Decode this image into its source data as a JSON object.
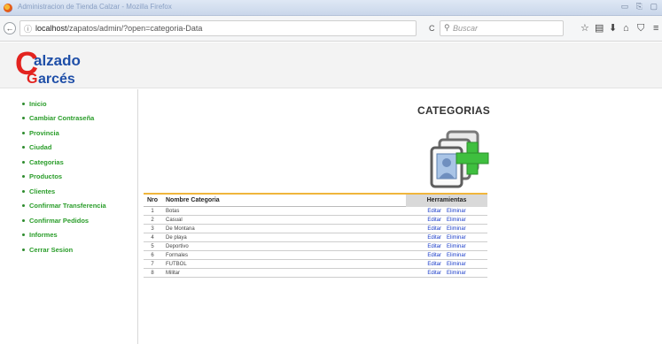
{
  "browser": {
    "window_title": "Administracion de Tienda Calzar - Mozilla Firefox",
    "url_host": "localhost",
    "url_path": "/zapatos/admin/?open=categoria-Data",
    "search_placeholder": "Buscar",
    "reload_glyph": "C",
    "back_glyph": "←"
  },
  "logo": {
    "text_line1": "alzado",
    "text_line2": "arcés",
    "initial1": "C",
    "initial2": "G",
    "colors": {
      "red": "#e3231f",
      "blue": "#1f4fa8"
    }
  },
  "sidebar": {
    "items": [
      {
        "label": "Inicio"
      },
      {
        "label": "Cambiar Contraseña"
      },
      {
        "label": "Provincia"
      },
      {
        "label": "Ciudad"
      },
      {
        "label": "Categorias"
      },
      {
        "label": "Productos"
      },
      {
        "label": "Clientes"
      },
      {
        "label": "Confirmar Transferencia"
      },
      {
        "label": "Confirmar Pedidos"
      },
      {
        "label": "Informes"
      },
      {
        "label": "Cerrar Sesion"
      }
    ]
  },
  "main": {
    "title": "CATEGORIAS",
    "table": {
      "headers": {
        "nro": "Nro",
        "name": "Nombre Categoria",
        "tools": "Herramientas"
      },
      "rows": [
        {
          "nro": "1",
          "name": "Botas",
          "edit": "Editar",
          "delete": "Eliminar"
        },
        {
          "nro": "2",
          "name": "Casual",
          "edit": "Editar",
          "delete": "Eliminar"
        },
        {
          "nro": "3",
          "name": "De Montana",
          "edit": "Editar",
          "delete": "Eliminar"
        },
        {
          "nro": "4",
          "name": "De playa",
          "edit": "Editar",
          "delete": "Eliminar"
        },
        {
          "nro": "5",
          "name": "Deportivo",
          "edit": "Editar",
          "delete": "Eliminar"
        },
        {
          "nro": "6",
          "name": "Formales",
          "edit": "Editar",
          "delete": "Eliminar"
        },
        {
          "nro": "7",
          "name": "FUTBOL",
          "edit": "Editar",
          "delete": "Eliminar"
        },
        {
          "nro": "8",
          "name": "Militar",
          "edit": "Editar",
          "delete": "Eliminar"
        }
      ]
    }
  },
  "colors": {
    "menu_green": "#2a9d2a",
    "link_blue": "#1a3cc9",
    "table_accent": "#f0b63c",
    "icon_green": "#3fbf3f"
  }
}
